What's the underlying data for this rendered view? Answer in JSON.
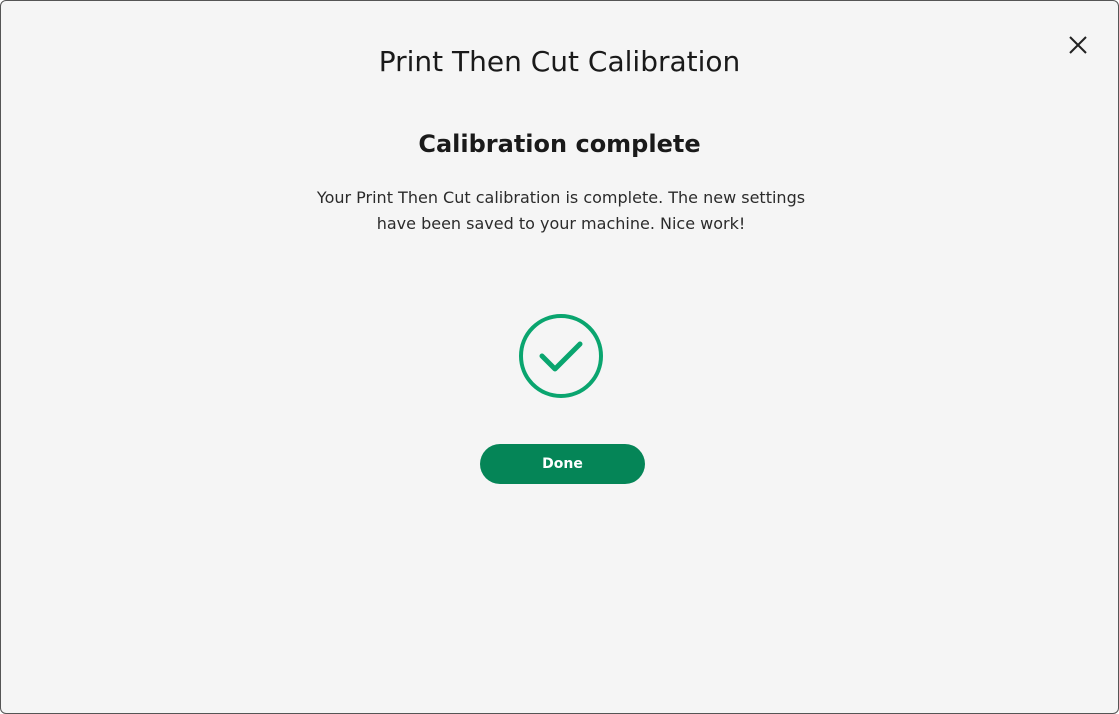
{
  "dialog": {
    "title": "Print Then Cut Calibration",
    "close_icon": "close-icon"
  },
  "content": {
    "heading": "Calibration complete",
    "message": "Your Print Then Cut calibration is complete. The new settings have been saved to your machine. Nice work!",
    "status_icon": "check-circle-icon"
  },
  "actions": {
    "done_label": "Done"
  },
  "colors": {
    "accent": "#058557",
    "check": "#0aa56f",
    "background": "#f5f5f5"
  }
}
